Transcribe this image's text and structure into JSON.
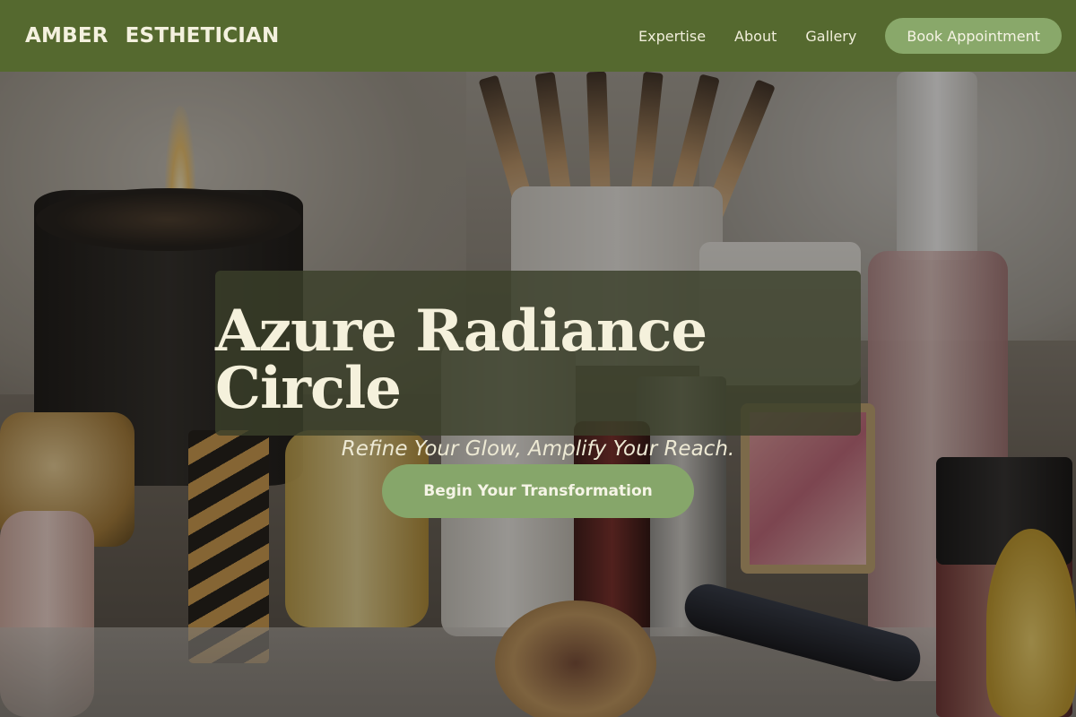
{
  "brand": {
    "word1": "AMBER",
    "word2": "ESTHETICIAN"
  },
  "nav": {
    "links": [
      "Expertise",
      "About",
      "Gallery"
    ],
    "cta_label": "Book Appointment"
  },
  "hero": {
    "title": "Azure Radiance Circle",
    "tagline": "Refine Your Glow, Amplify Your Reach.",
    "cta_label": "Begin Your Transformation",
    "background_image": "cosmetics-vanity-photo"
  },
  "colors": {
    "header_bg": "#55692f",
    "accent_green": "#86a66a",
    "text_cream": "#f5f1dc"
  }
}
